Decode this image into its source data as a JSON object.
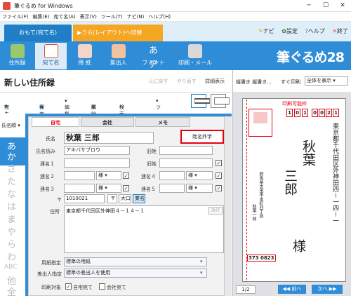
{
  "window": {
    "title": "筆ぐるめ for Windows",
    "controls": [
      "─",
      "☐",
      "✕"
    ]
  },
  "menu": [
    "ファイル(F)",
    "編集(E)",
    "宛て名(A)",
    "表示(V)",
    "ツール(T)",
    "ナビ(N)",
    "ヘルプ(H)"
  ],
  "mode": {
    "current": "おもて(宛て名)",
    "switch": "▶うら(レイアウト)へ切替"
  },
  "toplinks": {
    "navi": "ナビ",
    "settings": "設定",
    "help": "ヘルプ",
    "exit": "終了"
  },
  "ribbon": {
    "buttons": [
      "住所録",
      "宛て名",
      "用 紙",
      "差出人",
      "フォント",
      "印刷・メール"
    ],
    "active_index": 1,
    "logo": "筆ぐるめ28",
    "font_icon_text": "あア"
  },
  "header": {
    "title": "新しい住所録",
    "undo": "元に戻す",
    "redo": "やり直す",
    "detail": "詳細表示"
  },
  "toolbar": {
    "add": "宛先追加",
    "save": "保存",
    "edit": "編集",
    "delete": "削除",
    "search": "検索",
    "tools": "ツール"
  },
  "sidebar": {
    "sort": "氏名順",
    "kana": [
      "あ",
      "か",
      "さ",
      "た",
      "な",
      "は",
      "ま",
      "や",
      "ら",
      "わ",
      "ABC",
      "他",
      "全"
    ]
  },
  "form": {
    "tabs": [
      "自宅",
      "会社",
      "メモ"
    ],
    "labels": {
      "name": "氏名",
      "kana": "氏名読み",
      "rel1": "連名１",
      "rel2": "連名２",
      "rel3": "連名３",
      "rel4": "連名４",
      "rel5": "連名５",
      "old": "旧姓",
      "postal": "〒",
      "address": "住所",
      "paper": "用紙指定",
      "sender": "差出人指定",
      "print": "印刷対象"
    },
    "name_value": "秋葉 三郎",
    "kana_value": "アキバサブロウ",
    "honorific": "様",
    "postal_value": "1010021",
    "postal_btns": [
      "〒",
      "大口",
      "業名"
    ],
    "address_value": "東京都千代田区外神田４－１４－１",
    "gaiji_button": "姓名外字",
    "kaigyo": "改行",
    "paper_value": "標準の用紙",
    "sender_value": "標準の差出人を使用",
    "print_home": "自宅宛て",
    "print_company": "会社宛て"
  },
  "preview": {
    "label": "縦書き 縦書き...",
    "font_label": "すぐ印刷",
    "zoom": "全体を表示",
    "printable": "印刷可能枠",
    "postal_digits": [
      "1",
      "0",
      "1",
      "0",
      "0",
      "2",
      "1"
    ],
    "address": "東京都千代田区外神田四－一四－一",
    "name_line1": "秋葉",
    "name_line2": "三郎",
    "honorific": "様",
    "sender_addr": "群馬県太田市本町四丁目",
    "sender_name": "秋葉一郎",
    "sender_postal": "373 0823",
    "page": "1/2",
    "prev": "前へ",
    "next": "次へ"
  },
  "colors": {
    "accent": "#2f8cd6",
    "highlight": "#e60012",
    "switch": "#f5a623"
  }
}
